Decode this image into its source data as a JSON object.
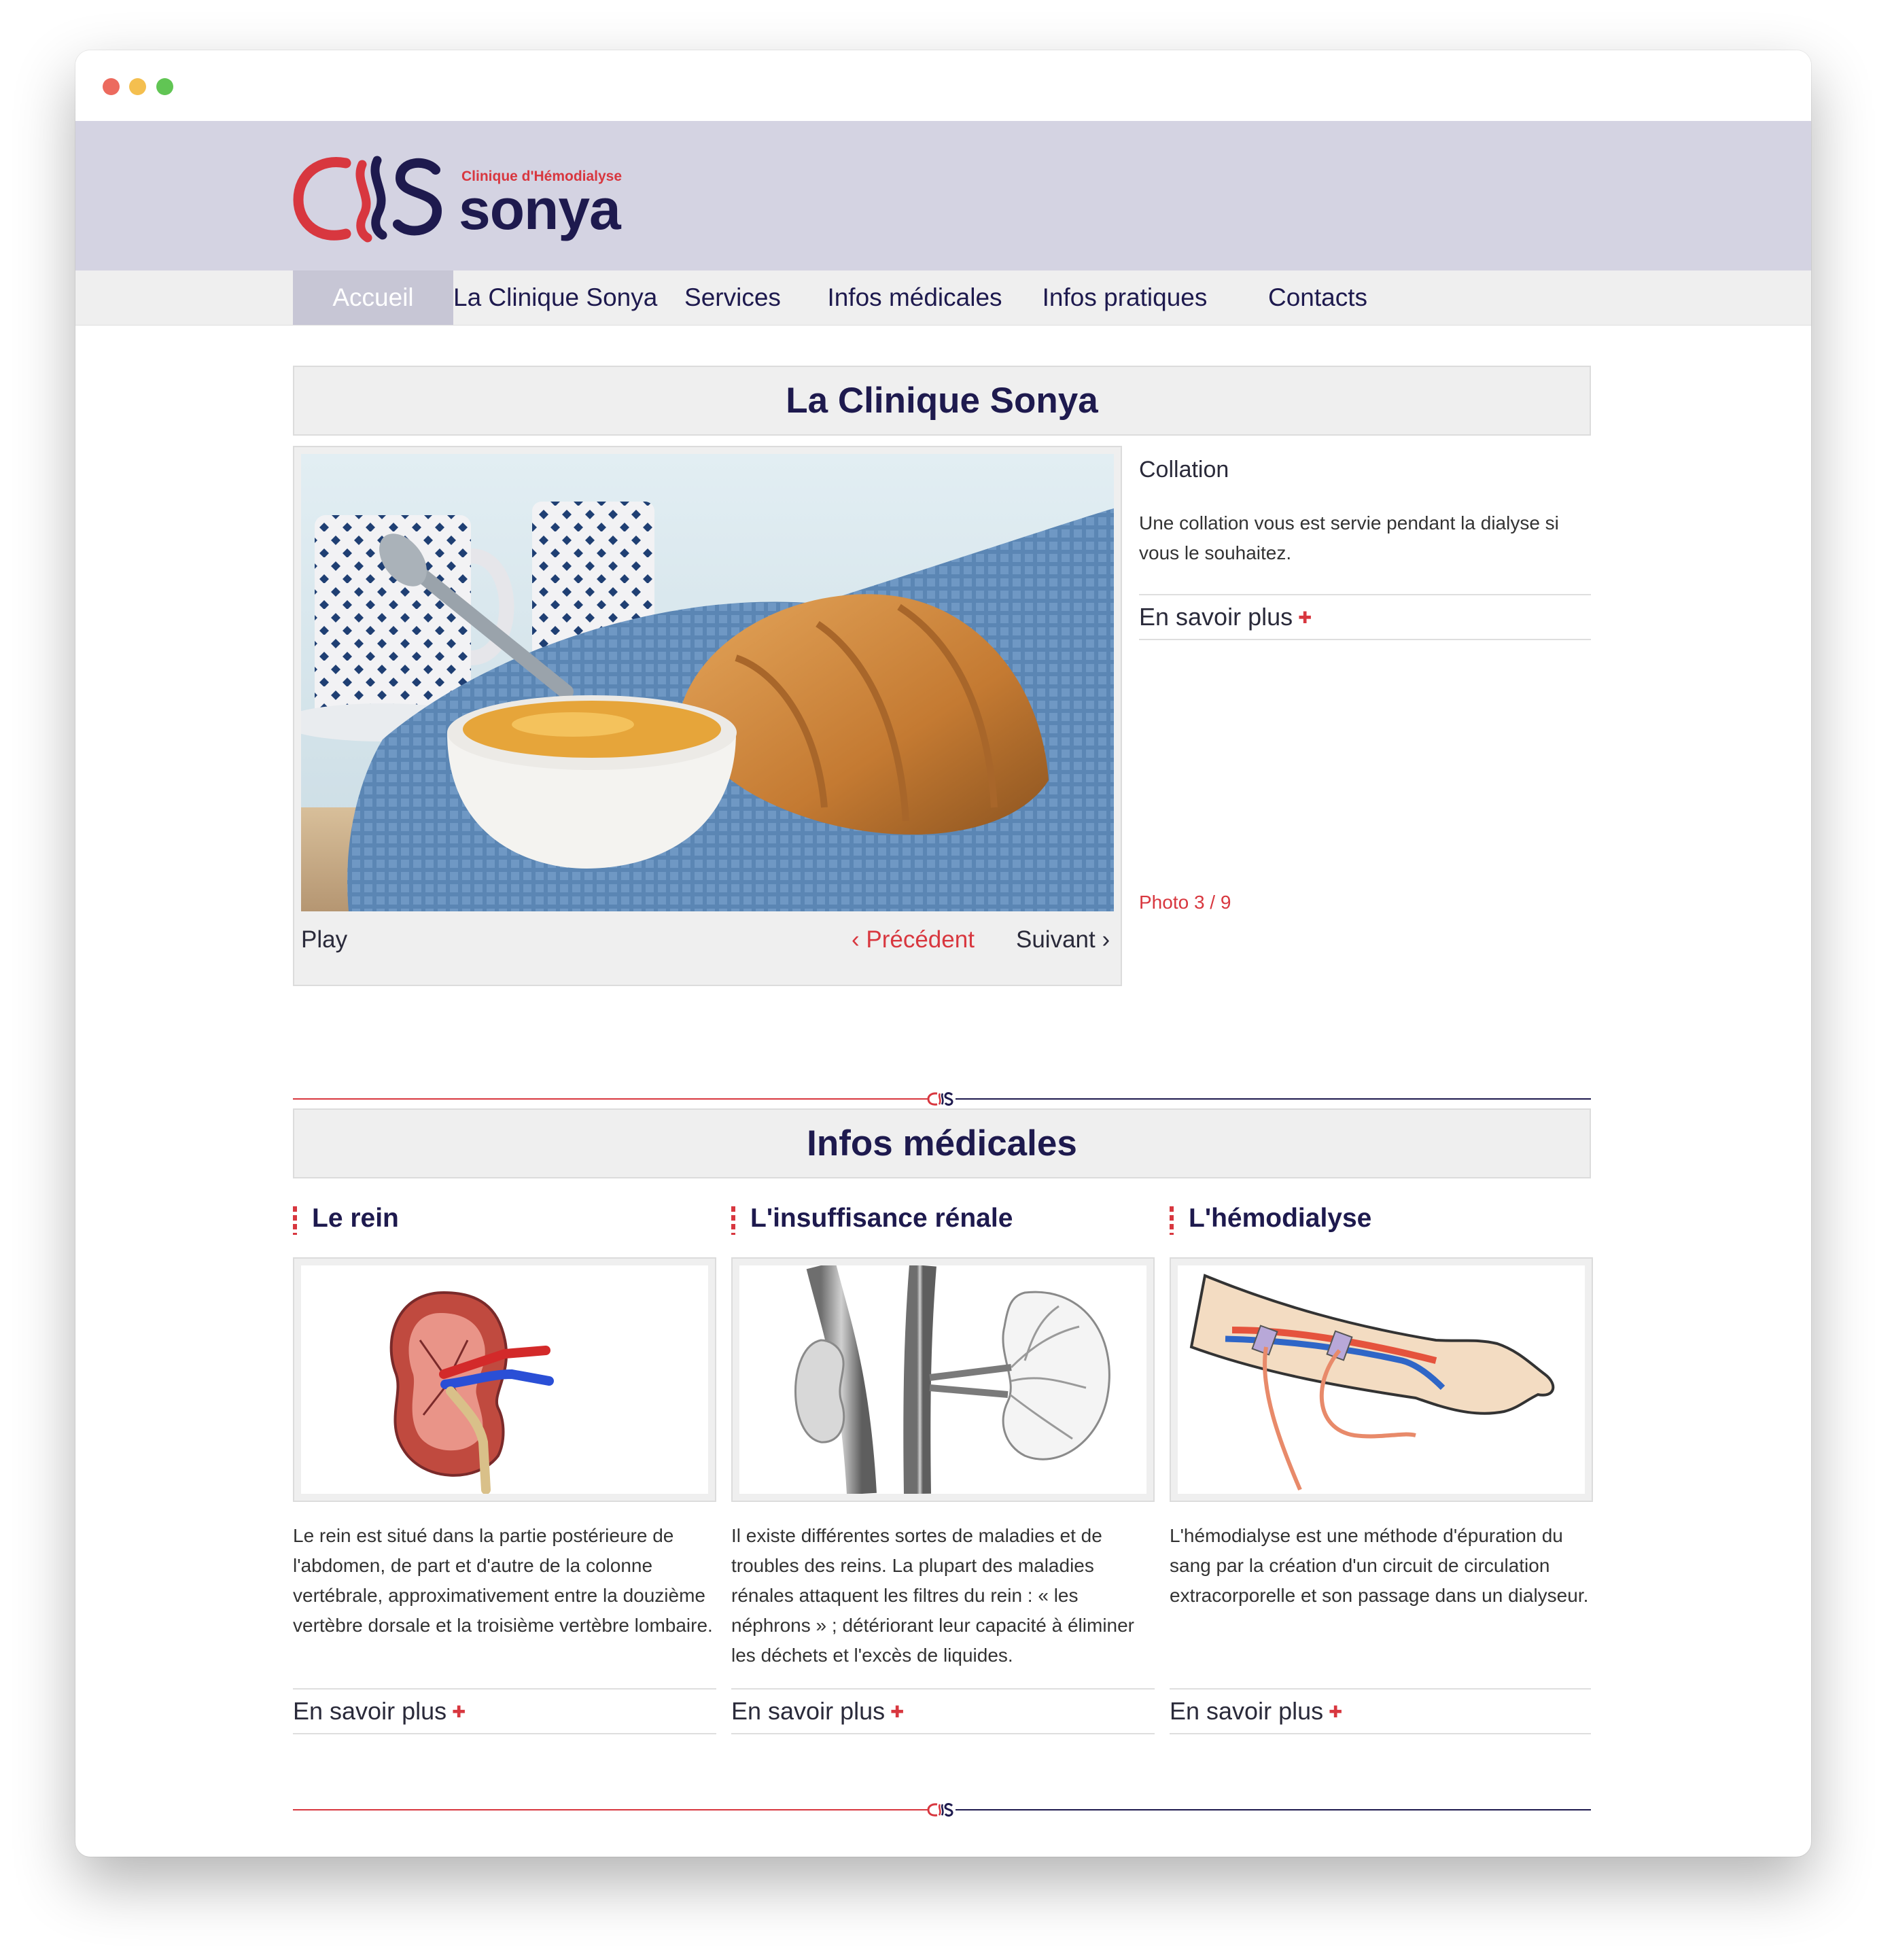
{
  "logo": {
    "mark": "CHS",
    "subtitle": "Clinique d'Hémodialyse",
    "name": "sonya"
  },
  "nav": {
    "items": [
      "Accueil",
      "La Clinique Sonya",
      "Services",
      "Infos médicales",
      "Infos pratiques",
      "Contacts"
    ],
    "active": "Accueil"
  },
  "clinic": {
    "heading": "La Clinique Sonya",
    "slider": {
      "play_label": "Play",
      "prev_label": "‹ Précédent",
      "next_label": "Suivant ›",
      "slide_title": "Collation",
      "slide_text": "Une collation vous est servie pendant la dialyse si vous le souhaitez.",
      "more_label": "En savoir plus",
      "counter": "Photo 3 / 9",
      "current": 3,
      "total": 9
    }
  },
  "medical": {
    "heading": "Infos médicales",
    "columns": [
      {
        "title": "Le rein",
        "image_icon": "kidney-illustration",
        "text": "Le rein est situé dans la partie postérieure de l'abdomen, de part et d'autre de la colonne vertébrale, approximativement entre la douzième vertèbre dorsale et la troisième vertèbre lombaire.",
        "more_label": "En savoir plus"
      },
      {
        "title": "L'insuffisance rénale",
        "image_icon": "renal-anatomy-illustration",
        "text": "Il existe différentes sortes de maladies et de troubles des reins. La plupart des maladies rénales attaquent les filtres du rein : « les néphrons » ; détériorant leur capacité à éliminer les déchets et l'excès de liquides.",
        "more_label": "En savoir plus"
      },
      {
        "title": "L'hémodialyse",
        "image_icon": "dialysis-arm-illustration",
        "text": "L'hémodialyse est une méthode d'épuration du sang par la création d'un circuit de circulation extracorporelle et son passage dans un dialyseur.",
        "more_label": "En savoir plus"
      }
    ]
  },
  "divider_mark": "CHS",
  "colors": {
    "brand_navy": "#1e1a4e",
    "brand_red": "#d8373f",
    "header_band": "#d4d3e2",
    "nav_active": "#c7c6d5"
  }
}
